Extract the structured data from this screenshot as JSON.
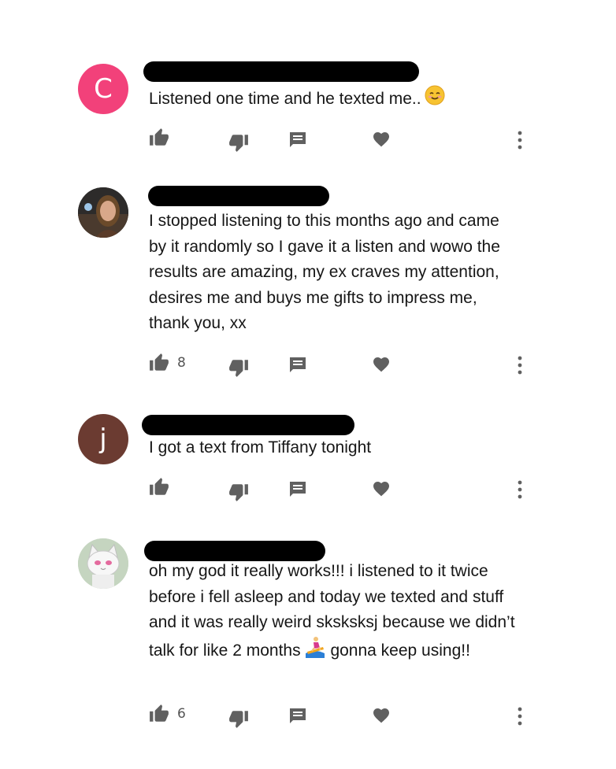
{
  "colors": {
    "icon": "#606060",
    "avatar_c": "#f2417a",
    "avatar_j": "#6b3b31",
    "text": "#161616"
  },
  "comments": [
    {
      "avatar_letter": "C",
      "avatar_color": "#f2417a",
      "author_redacted": true,
      "text": "Listened one time and he texted me..",
      "emoji": "smiling-face",
      "like_count": ""
    },
    {
      "avatar_letter": "",
      "avatar_image": "photo-avatar",
      "author_redacted": true,
      "text": "I stopped listening to this months ago and came by it randomly so I gave it a listen and wowo the results are amazing, my ex craves my attention, desires me and buys me gifts to impress me, thank you, xx",
      "like_count": "8"
    },
    {
      "avatar_letter": "j",
      "avatar_color": "#6b3b31",
      "author_redacted": true,
      "text": "I got a text from Tiffany tonight",
      "like_count": ""
    },
    {
      "avatar_letter": "",
      "avatar_image": "cat-avatar",
      "author_redacted": true,
      "text_before_emoji": "oh my god it really works!!! i listened to it twice before i fell asleep and today we texted and stuff and it was really weird sksksksj because we didn’t talk for like 2 months",
      "emoji": "person-surfing",
      "text_after_emoji": "gonna keep using!!",
      "like_count": "6"
    }
  ],
  "icons": {
    "like": "thumbs-up-icon",
    "dislike": "thumbs-down-icon",
    "reply": "reply-icon",
    "heart": "heart-icon",
    "more": "more-vert-icon"
  }
}
